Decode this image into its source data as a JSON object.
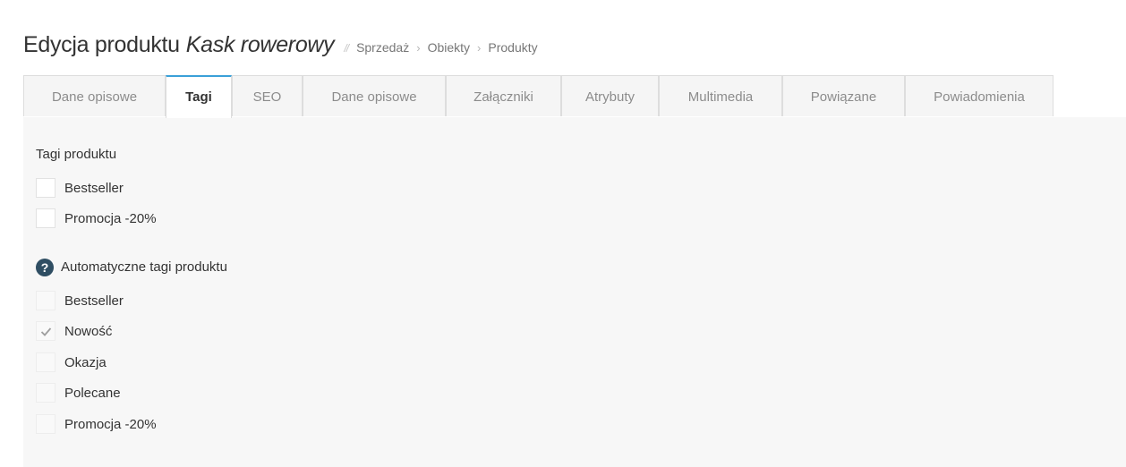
{
  "header": {
    "title_prefix": "Edycja produktu",
    "product_name": "Kask rowerowy",
    "separator": "//",
    "breadcrumb": [
      "Sprzedaż",
      "Obiekty",
      "Produkty"
    ],
    "breadcrumb_chevron": "›"
  },
  "tabs": [
    {
      "label": "Dane opisowe",
      "active": false
    },
    {
      "label": "Tagi",
      "active": true
    },
    {
      "label": "SEO",
      "active": false
    },
    {
      "label": "Dane opisowe",
      "active": false
    },
    {
      "label": "Załączniki",
      "active": false
    },
    {
      "label": "Atrybuty",
      "active": false
    },
    {
      "label": "Multimedia",
      "active": false
    },
    {
      "label": "Powiązane",
      "active": false
    },
    {
      "label": "Powiadomienia",
      "active": false
    }
  ],
  "product_tags": {
    "label": "Tagi produktu",
    "items": [
      {
        "label": "Bestseller",
        "checked": false
      },
      {
        "label": "Promocja -20%",
        "checked": false
      }
    ]
  },
  "auto_tags": {
    "label": "Automatyczne tagi produktu",
    "help_icon": "question-circle-icon",
    "help_glyph": "?",
    "items": [
      {
        "label": "Bestseller",
        "checked": false
      },
      {
        "label": "Nowość",
        "checked": true
      },
      {
        "label": "Okazja",
        "checked": false
      },
      {
        "label": "Polecane",
        "checked": false
      },
      {
        "label": "Promocja -20%",
        "checked": false
      }
    ]
  },
  "colors": {
    "accent": "#3aa0d8",
    "help_icon": "#2f4e63",
    "text": "#333333",
    "muted_text": "#8c8c8c",
    "panel_bg": "#f7f7f7"
  }
}
